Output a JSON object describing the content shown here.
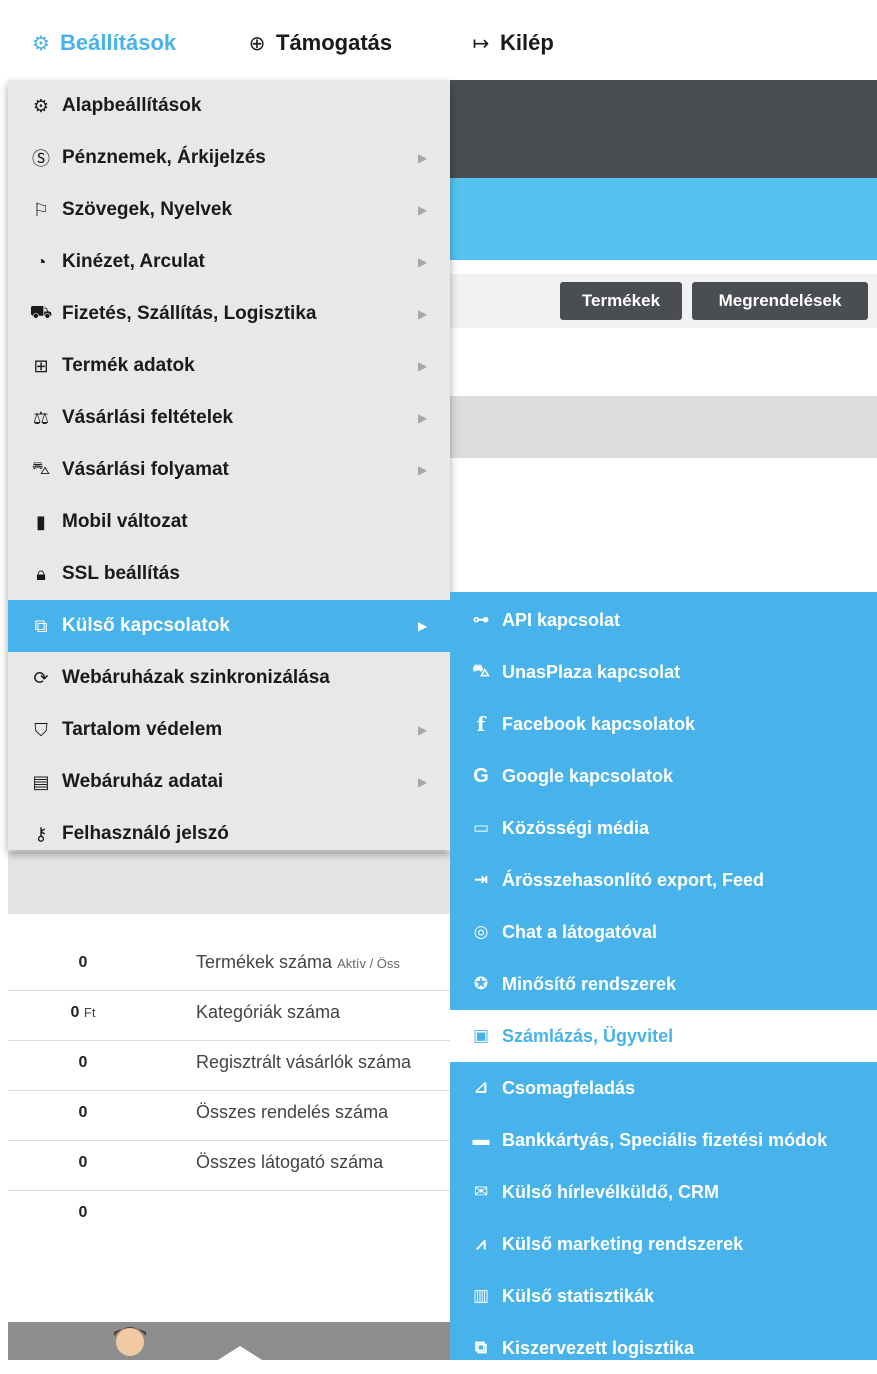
{
  "topnav": {
    "settings_label": "Beállítások",
    "support_label": "Támogatás",
    "logout_label": "Kilép",
    "accent": "#47b3ea"
  },
  "toolbar": {
    "products_label": "Termékek",
    "orders_label": "Megrendelések"
  },
  "menu": {
    "items": [
      {
        "label": "Alapbeállítások",
        "icon": "gears-icon",
        "has_submenu": false
      },
      {
        "label": "Pénznemek, Árkijelzés",
        "icon": "currency-icon",
        "has_submenu": true
      },
      {
        "label": "Szövegek, Nyelvek",
        "icon": "flag-icon",
        "has_submenu": true
      },
      {
        "label": "Kinézet, Arculat",
        "icon": "palette-icon",
        "has_submenu": true
      },
      {
        "label": "Fizetés, Szállítás, Logisztika",
        "icon": "truck-icon",
        "has_submenu": true
      },
      {
        "label": "Termék adatok",
        "icon": "box-icon",
        "has_submenu": true
      },
      {
        "label": "Vásárlási feltételek",
        "icon": "gavel-icon",
        "has_submenu": true
      },
      {
        "label": "Vásárlási folyamat",
        "icon": "cart-icon",
        "has_submenu": true
      },
      {
        "label": "Mobil változat",
        "icon": "mobile-icon",
        "has_submenu": false
      },
      {
        "label": "SSL beállítás",
        "icon": "lock-icon",
        "has_submenu": false
      },
      {
        "label": "Külső kapcsolatok",
        "icon": "external-link-icon",
        "has_submenu": true,
        "active": true
      },
      {
        "label": "Webáruházak szinkronizálása",
        "icon": "sync-icon",
        "has_submenu": false
      },
      {
        "label": "Tartalom védelem",
        "icon": "shield-icon",
        "has_submenu": true
      },
      {
        "label": "Webáruház adatai",
        "icon": "document-icon",
        "has_submenu": true
      },
      {
        "label": "Felhasználó jelszó",
        "icon": "key-icon",
        "has_submenu": false
      }
    ]
  },
  "submenu": {
    "items": [
      {
        "label": "API kapcsolat",
        "icon": "sitemap-icon"
      },
      {
        "label": "UnasPlaza kapcsolat",
        "icon": "cart-icon"
      },
      {
        "label": "Facebook kapcsolatok",
        "icon": "facebook-icon"
      },
      {
        "label": "Google kapcsolatok",
        "icon": "google-icon"
      },
      {
        "label": "Közösségi média",
        "icon": "chat-icon"
      },
      {
        "label": "Árösszehasonlító export, Feed",
        "icon": "file-export-icon"
      },
      {
        "label": "Chat a látogatóval",
        "icon": "user-circle-icon"
      },
      {
        "label": "Minősítő rendszerek",
        "icon": "award-icon"
      },
      {
        "label": "Számlázás, Ügyvitel",
        "icon": "invoice-icon",
        "active": true
      },
      {
        "label": "Csomagfeladás",
        "icon": "dolly-icon"
      },
      {
        "label": "Bankkártyás, Speciális fizetési módok",
        "icon": "credit-card-icon"
      },
      {
        "label": "Külső hírlevélküldő, CRM",
        "icon": "envelope-icon"
      },
      {
        "label": "Külső marketing rendszerek",
        "icon": "line-chart-icon"
      },
      {
        "label": "Külső statisztikák",
        "icon": "bar-chart-icon"
      },
      {
        "label": "Kiszervezett logisztika",
        "icon": "external-link-icon"
      }
    ]
  },
  "stats": {
    "rows": [
      {
        "value": "0",
        "unit": "",
        "label": "Termékek száma",
        "sub": "Aktív / Öss"
      },
      {
        "value": "0",
        "unit": "Ft",
        "label": "Kategóriák száma",
        "sub": ""
      },
      {
        "value": "0",
        "unit": "",
        "label": "Regisztrált vásárlók száma",
        "sub": ""
      },
      {
        "value": "0",
        "unit": "",
        "label": "Összes rendelés száma",
        "sub": ""
      },
      {
        "value": "0",
        "unit": "",
        "label": "Összes látogató száma",
        "sub": ""
      },
      {
        "value": "0",
        "unit": "",
        "label": "",
        "sub": ""
      }
    ]
  }
}
